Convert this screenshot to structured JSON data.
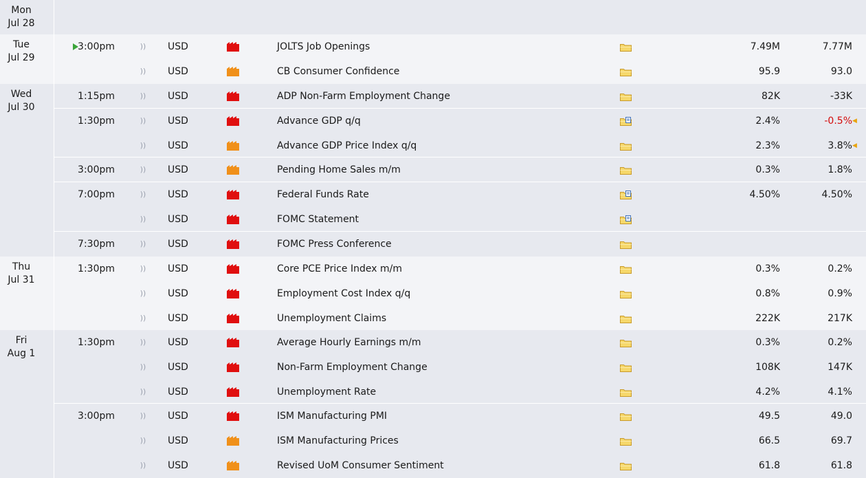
{
  "days": [
    {
      "day": "Mon",
      "date": "Jul 28",
      "events": []
    },
    {
      "day": "Tue",
      "date": "Jul 29",
      "events": [
        {
          "time": "3:00pm",
          "now": true,
          "currency": "USD",
          "impact": "high",
          "title": "JOLTS Job Openings",
          "detail": "folder",
          "forecast": "7.49M",
          "previous": "7.77M"
        },
        {
          "time": "",
          "currency": "USD",
          "impact": "medium",
          "title": "CB Consumer Confidence",
          "detail": "folder",
          "forecast": "95.9",
          "previous": "93.0"
        }
      ]
    },
    {
      "day": "Wed",
      "date": "Jul 30",
      "events": [
        {
          "time": "1:15pm",
          "currency": "USD",
          "impact": "high",
          "title": "ADP Non-Farm Employment Change",
          "detail": "folder",
          "forecast": "82K",
          "previous": "-33K"
        },
        {
          "time": "1:30pm",
          "currency": "USD",
          "impact": "high",
          "title": "Advance GDP q/q",
          "detail": "folder-doc",
          "forecast": "2.4%",
          "previous": "-0.5%",
          "previous_status": "revised",
          "previous_color": "#d40b0b"
        },
        {
          "time": "",
          "currency": "USD",
          "impact": "medium",
          "title": "Advance GDP Price Index q/q",
          "detail": "folder",
          "forecast": "2.3%",
          "previous": "3.8%",
          "previous_status": "revised"
        },
        {
          "time": "3:00pm",
          "currency": "USD",
          "impact": "medium",
          "title": "Pending Home Sales m/m",
          "detail": "folder",
          "forecast": "0.3%",
          "previous": "1.8%"
        },
        {
          "time": "7:00pm",
          "currency": "USD",
          "impact": "high",
          "title": "Federal Funds Rate",
          "detail": "folder-doc",
          "forecast": "4.50%",
          "previous": "4.50%"
        },
        {
          "time": "",
          "currency": "USD",
          "impact": "high",
          "title": "FOMC Statement",
          "detail": "folder-doc",
          "forecast": "",
          "previous": ""
        },
        {
          "time": "7:30pm",
          "currency": "USD",
          "impact": "high",
          "title": "FOMC Press Conference",
          "detail": "folder",
          "forecast": "",
          "previous": ""
        }
      ]
    },
    {
      "day": "Thu",
      "date": "Jul 31",
      "events": [
        {
          "time": "1:30pm",
          "currency": "USD",
          "impact": "high",
          "title": "Core PCE Price Index m/m",
          "detail": "folder",
          "forecast": "0.3%",
          "previous": "0.2%"
        },
        {
          "time": "",
          "currency": "USD",
          "impact": "high",
          "title": "Employment Cost Index q/q",
          "detail": "folder",
          "forecast": "0.8%",
          "previous": "0.9%"
        },
        {
          "time": "",
          "currency": "USD",
          "impact": "high",
          "title": "Unemployment Claims",
          "detail": "folder",
          "forecast": "222K",
          "previous": "217K"
        }
      ]
    },
    {
      "day": "Fri",
      "date": "Aug 1",
      "events": [
        {
          "time": "1:30pm",
          "currency": "USD",
          "impact": "high",
          "title": "Average Hourly Earnings m/m",
          "detail": "folder",
          "forecast": "0.3%",
          "previous": "0.2%"
        },
        {
          "time": "",
          "currency": "USD",
          "impact": "high",
          "title": "Non-Farm Employment Change",
          "detail": "folder",
          "forecast": "108K",
          "previous": "147K"
        },
        {
          "time": "",
          "currency": "USD",
          "impact": "high",
          "title": "Unemployment Rate",
          "detail": "folder",
          "forecast": "4.2%",
          "previous": "4.1%"
        },
        {
          "time": "3:00pm",
          "currency": "USD",
          "impact": "high",
          "title": "ISM Manufacturing PMI",
          "detail": "folder",
          "forecast": "49.5",
          "previous": "49.0"
        },
        {
          "time": "",
          "currency": "USD",
          "impact": "medium",
          "title": "ISM Manufacturing Prices",
          "detail": "folder",
          "forecast": "66.5",
          "previous": "69.7"
        },
        {
          "time": "",
          "currency": "USD",
          "impact": "medium",
          "title": "Revised UoM Consumer Sentiment",
          "detail": "folder",
          "forecast": "61.8",
          "previous": "61.8"
        }
      ]
    }
  ],
  "colors": {
    "impact_high": "#e00f0f",
    "impact_medium": "#f0901a",
    "revised_marker": "#e8a40f",
    "row_shaded": "#e7e9ef",
    "row_light": "#f3f4f7"
  }
}
